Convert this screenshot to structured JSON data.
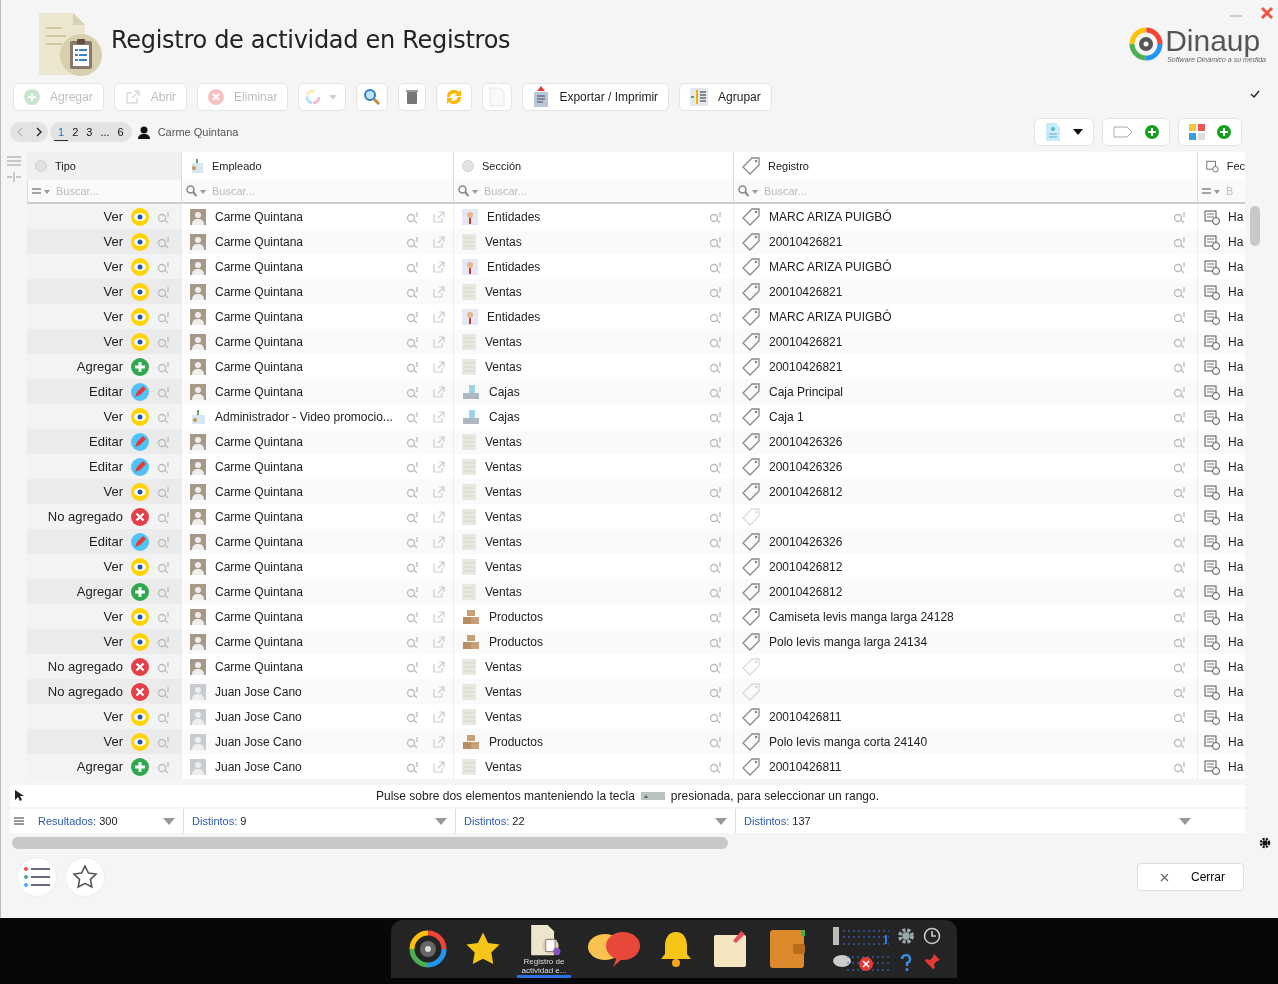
{
  "window": {
    "title": "Registro de actividad en Registros"
  },
  "brand": {
    "name": "Dinaup",
    "tagline": "Software Dinámico a su medida"
  },
  "toolbar": [
    {
      "kind": "add",
      "label": "Agregar",
      "disabled": true
    },
    {
      "kind": "open",
      "label": "Abrir",
      "disabled": true
    },
    {
      "kind": "delete",
      "label": "Eliminar",
      "disabled": true
    },
    {
      "kind": "color",
      "disabled": true
    },
    {
      "kind": "search",
      "disabled": false
    },
    {
      "kind": "trash",
      "disabled": false
    },
    {
      "kind": "refresh",
      "disabled": false
    },
    {
      "kind": "blank",
      "disabled": true
    },
    {
      "kind": "export",
      "label": "Exportar / Imprimir",
      "disabled": false
    },
    {
      "kind": "group",
      "label": "Agrupar",
      "disabled": false
    }
  ],
  "pager": {
    "pages": [
      {
        "label": "1",
        "selected": true
      },
      {
        "label": "2",
        "selected": false
      },
      {
        "label": "3",
        "selected": false
      },
      {
        "label": "...",
        "selected": false
      },
      {
        "label": "6",
        "selected": false
      }
    ],
    "user": "Carme Quintana"
  },
  "table": {
    "columns": [
      {
        "kind": "tipo",
        "label": "Tipo",
        "placeholder": "Buscar..."
      },
      {
        "kind": "empleado",
        "label": "Empleado",
        "placeholder": "Buscar..."
      },
      {
        "kind": "seccion",
        "label": "Sección",
        "placeholder": "Buscar..."
      },
      {
        "kind": "registro",
        "label": "Registro",
        "placeholder": "Buscar..."
      },
      {
        "kind": "fecha",
        "label": "Fec",
        "placeholder": "B"
      }
    ],
    "rows": [
      {
        "tipo": {
          "label": "Ver",
          "kind": "ver"
        },
        "empleado": {
          "label": "Carme Quintana",
          "kind": "person"
        },
        "seccion": {
          "label": "Entidades",
          "kind": "entidades"
        },
        "registro": "MARC ARIZA PUIGBÓ",
        "fecha": "Ha"
      },
      {
        "tipo": {
          "label": "Ver",
          "kind": "ver"
        },
        "empleado": {
          "label": "Carme Quintana",
          "kind": "person"
        },
        "seccion": {
          "label": "Ventas",
          "kind": "ventas"
        },
        "registro": "20010426821",
        "fecha": "Ha"
      },
      {
        "tipo": {
          "label": "Ver",
          "kind": "ver"
        },
        "empleado": {
          "label": "Carme Quintana",
          "kind": "person"
        },
        "seccion": {
          "label": "Entidades",
          "kind": "entidades"
        },
        "registro": "MARC ARIZA PUIGBÓ",
        "fecha": "Ha"
      },
      {
        "tipo": {
          "label": "Ver",
          "kind": "ver"
        },
        "empleado": {
          "label": "Carme Quintana",
          "kind": "person"
        },
        "seccion": {
          "label": "Ventas",
          "kind": "ventas"
        },
        "registro": "20010426821",
        "fecha": "Ha"
      },
      {
        "tipo": {
          "label": "Ver",
          "kind": "ver"
        },
        "empleado": {
          "label": "Carme Quintana",
          "kind": "person"
        },
        "seccion": {
          "label": "Entidades",
          "kind": "entidades"
        },
        "registro": "MARC ARIZA PUIGBÓ",
        "fecha": "Ha"
      },
      {
        "tipo": {
          "label": "Ver",
          "kind": "ver"
        },
        "empleado": {
          "label": "Carme Quintana",
          "kind": "person"
        },
        "seccion": {
          "label": "Ventas",
          "kind": "ventas"
        },
        "registro": "20010426821",
        "fecha": "Ha"
      },
      {
        "tipo": {
          "label": "Agregar",
          "kind": "agregar"
        },
        "empleado": {
          "label": "Carme Quintana",
          "kind": "person"
        },
        "seccion": {
          "label": "Ventas",
          "kind": "ventas"
        },
        "registro": "20010426821",
        "fecha": "Ha"
      },
      {
        "tipo": {
          "label": "Editar",
          "kind": "editar"
        },
        "empleado": {
          "label": "Carme Quintana",
          "kind": "person"
        },
        "seccion": {
          "label": "Cajas",
          "kind": "cajas"
        },
        "registro": "Caja Principal",
        "fecha": "Ha"
      },
      {
        "tipo": {
          "label": "Ver",
          "kind": "ver"
        },
        "empleado": {
          "label": "Administrador - Video promocio...",
          "kind": "admin"
        },
        "seccion": {
          "label": "Cajas",
          "kind": "cajas"
        },
        "registro": "Caja 1",
        "fecha": "Ha"
      },
      {
        "tipo": {
          "label": "Editar",
          "kind": "editar"
        },
        "empleado": {
          "label": "Carme Quintana",
          "kind": "person"
        },
        "seccion": {
          "label": "Ventas",
          "kind": "ventas"
        },
        "registro": "20010426326",
        "fecha": "Ha"
      },
      {
        "tipo": {
          "label": "Editar",
          "kind": "editar"
        },
        "empleado": {
          "label": "Carme Quintana",
          "kind": "person"
        },
        "seccion": {
          "label": "Ventas",
          "kind": "ventas"
        },
        "registro": "20010426326",
        "fecha": "Ha"
      },
      {
        "tipo": {
          "label": "Ver",
          "kind": "ver"
        },
        "empleado": {
          "label": "Carme Quintana",
          "kind": "person"
        },
        "seccion": {
          "label": "Ventas",
          "kind": "ventas"
        },
        "registro": "20010426812",
        "fecha": "Ha"
      },
      {
        "tipo": {
          "label": "No agregado",
          "kind": "no_agregado"
        },
        "empleado": {
          "label": "Carme Quintana",
          "kind": "person"
        },
        "seccion": {
          "label": "Ventas",
          "kind": "ventas"
        },
        "fecha": "Ha"
      },
      {
        "tipo": {
          "label": "Editar",
          "kind": "editar"
        },
        "empleado": {
          "label": "Carme Quintana",
          "kind": "person"
        },
        "seccion": {
          "label": "Ventas",
          "kind": "ventas"
        },
        "registro": "20010426326",
        "fecha": "Ha"
      },
      {
        "tipo": {
          "label": "Ver",
          "kind": "ver"
        },
        "empleado": {
          "label": "Carme Quintana",
          "kind": "person"
        },
        "seccion": {
          "label": "Ventas",
          "kind": "ventas"
        },
        "registro": "20010426812",
        "fecha": "Ha"
      },
      {
        "tipo": {
          "label": "Agregar",
          "kind": "agregar"
        },
        "empleado": {
          "label": "Carme Quintana",
          "kind": "person"
        },
        "seccion": {
          "label": "Ventas",
          "kind": "ventas"
        },
        "registro": "20010426812",
        "fecha": "Ha"
      },
      {
        "tipo": {
          "label": "Ver",
          "kind": "ver"
        },
        "empleado": {
          "label": "Carme Quintana",
          "kind": "person"
        },
        "seccion": {
          "label": "Productos",
          "kind": "productos"
        },
        "registro": "Camiseta levis manga larga 24128",
        "fecha": "Ha"
      },
      {
        "tipo": {
          "label": "Ver",
          "kind": "ver"
        },
        "empleado": {
          "label": "Carme Quintana",
          "kind": "person"
        },
        "seccion": {
          "label": "Productos",
          "kind": "productos"
        },
        "registro": "Polo levis manga larga 24134",
        "fecha": "Ha"
      },
      {
        "tipo": {
          "label": "No agregado",
          "kind": "no_agregado"
        },
        "empleado": {
          "label": "Carme Quintana",
          "kind": "person"
        },
        "seccion": {
          "label": "Ventas",
          "kind": "ventas"
        },
        "fecha": "Ha"
      },
      {
        "tipo": {
          "label": "No agregado",
          "kind": "no_agregado"
        },
        "empleado": {
          "label": "Juan Jose Cano",
          "kind": "person2"
        },
        "seccion": {
          "label": "Ventas",
          "kind": "ventas"
        },
        "fecha": "Ha"
      },
      {
        "tipo": {
          "label": "Ver",
          "kind": "ver"
        },
        "empleado": {
          "label": "Juan Jose Cano",
          "kind": "person2"
        },
        "seccion": {
          "label": "Ventas",
          "kind": "ventas"
        },
        "registro": "20010426811",
        "fecha": "Ha"
      },
      {
        "tipo": {
          "label": "Ver",
          "kind": "ver"
        },
        "empleado": {
          "label": "Juan Jose Cano",
          "kind": "person2"
        },
        "seccion": {
          "label": "Productos",
          "kind": "productos"
        },
        "registro": "Polo levis manga corta 24140",
        "fecha": "Ha"
      },
      {
        "tipo": {
          "label": "Agregar",
          "kind": "agregar"
        },
        "empleado": {
          "label": "Juan Jose Cano",
          "kind": "person2"
        },
        "seccion": {
          "label": "Ventas",
          "kind": "ventas"
        },
        "registro": "20010426811",
        "fecha": "Ha"
      }
    ],
    "hint": {
      "before": "Pulse sobre dos elementos manteniendo la tecla",
      "after": "presionada, para seleccionar un rango."
    },
    "summary": [
      {
        "label": "Resultados:",
        "value": "300"
      },
      {
        "label": "Distintos:",
        "value": "9"
      },
      {
        "label": "Distintos:",
        "value": "22"
      },
      {
        "label": "Distintos:",
        "value": "137"
      }
    ]
  },
  "footer": {
    "close": "Cerrar"
  },
  "taskbar": {
    "apps": [
      {
        "kind": "logo",
        "selected": false
      },
      {
        "kind": "star",
        "selected": false
      },
      {
        "kind": "doc",
        "selected": true,
        "label": "Registro de actividad e..."
      },
      {
        "kind": "chat",
        "selected": false
      },
      {
        "kind": "bell",
        "selected": false
      },
      {
        "kind": "note",
        "selected": false
      },
      {
        "kind": "wallet",
        "selected": false
      }
    ]
  }
}
